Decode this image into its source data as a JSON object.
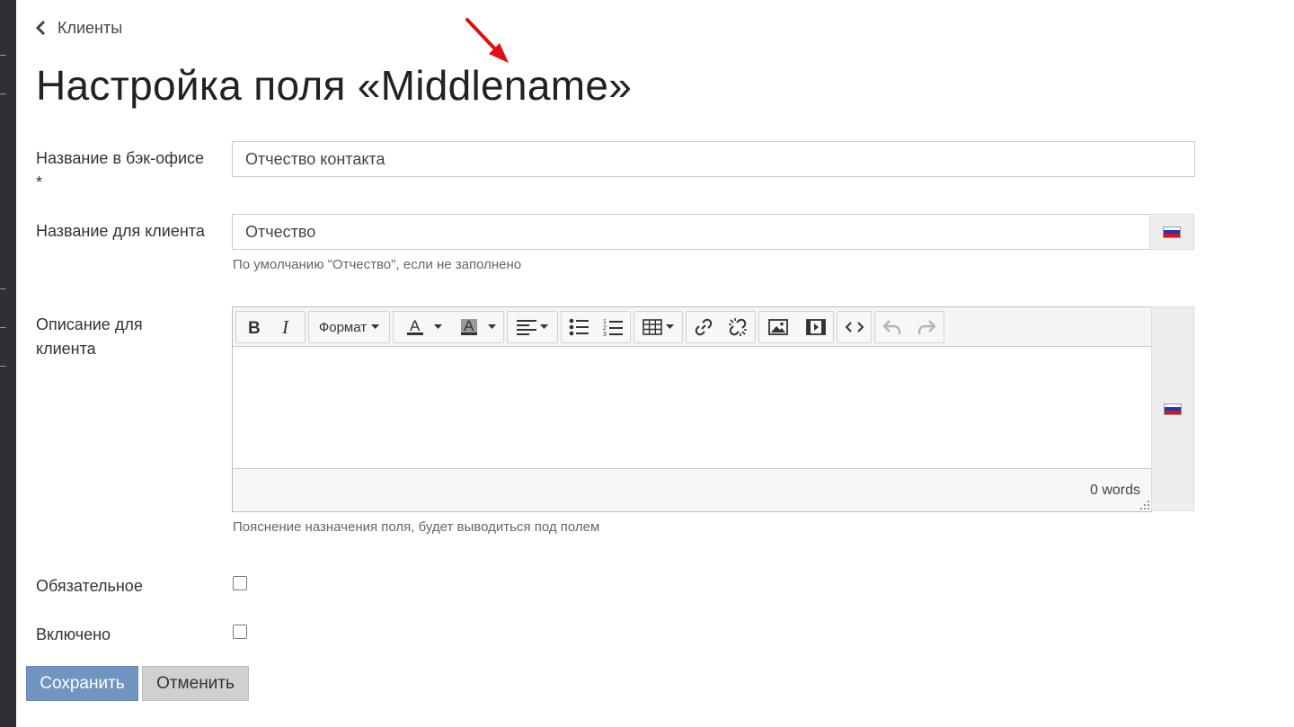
{
  "breadcrumb": {
    "back_label": "Клиенты"
  },
  "page": {
    "title": "Настройка поля «Middlename»"
  },
  "fields": {
    "backoffice_name": {
      "label": "Название в бэк-офисе *",
      "value": "Отчество контакта"
    },
    "client_name": {
      "label": "Название для клиента",
      "value": "Отчество",
      "help": "По умолчанию \"Отчество\", если не заполнено"
    },
    "client_description": {
      "label": "Описание для клиента",
      "help": "Пояснение назначения поля, будет выводиться под полем",
      "word_count": "0 words",
      "toolbar": {
        "format_label": "Формат"
      }
    },
    "required": {
      "label": "Обязательное",
      "checked": false
    },
    "enabled": {
      "label": "Включено",
      "checked": false
    }
  },
  "actions": {
    "save_label": "Сохранить",
    "cancel_label": "Отменить"
  },
  "colors": {
    "primary_button": "#7095c0",
    "secondary_button": "#d0d0d0",
    "annotation_arrow": "#e01010"
  },
  "icons": [
    "chevron-left-icon",
    "bold-icon",
    "italic-icon",
    "text-color-icon",
    "background-color-icon",
    "align-left-icon",
    "bullet-list-icon",
    "numbered-list-icon",
    "table-icon",
    "link-icon",
    "unlink-icon",
    "image-icon",
    "media-icon",
    "source-code-icon",
    "undo-icon",
    "redo-icon",
    "russian-flag-icon"
  ]
}
